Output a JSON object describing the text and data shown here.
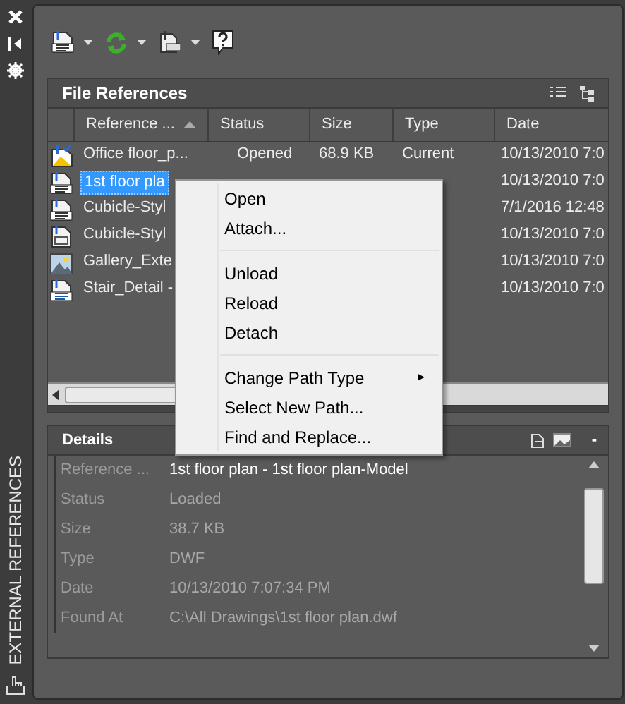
{
  "palette_title": "EXTERNAL REFERENCES",
  "file_references": {
    "title": "File References",
    "columns": [
      {
        "label": "Reference ...",
        "sorted": true
      },
      {
        "label": "Status",
        "sorted": false
      },
      {
        "label": "Size",
        "sorted": false
      },
      {
        "label": "Type",
        "sorted": false
      },
      {
        "label": "Date",
        "sorted": false
      }
    ],
    "rows": [
      {
        "kind": "current",
        "selected": false,
        "cells": [
          {
            "text": "Office floor_p..."
          },
          {
            "text": "Opened"
          },
          {
            "text": "68.9 KB"
          },
          {
            "text": "Current"
          },
          {
            "text": "10/13/2010 7:0"
          }
        ]
      },
      {
        "kind": "dwf",
        "selected": true,
        "cells": [
          {
            "text": "1st floor pla"
          },
          {
            "text": ""
          },
          {
            "text": ""
          },
          {
            "text": ""
          },
          {
            "text": "10/13/2010 7:0"
          }
        ]
      },
      {
        "kind": "dwg",
        "selected": false,
        "cells": [
          {
            "text": "Cubicle-Styl"
          },
          {
            "text": ""
          },
          {
            "text": ""
          },
          {
            "text": ""
          },
          {
            "text": "7/1/2016 12:48"
          }
        ]
      },
      {
        "kind": "sheet",
        "selected": false,
        "cells": [
          {
            "text": "Cubicle-Styl"
          },
          {
            "text": ""
          },
          {
            "text": ""
          },
          {
            "text": ""
          },
          {
            "text": "10/13/2010 7:0"
          }
        ]
      },
      {
        "kind": "image",
        "selected": false,
        "cells": [
          {
            "text": "Gallery_Exte"
          },
          {
            "text": ""
          },
          {
            "text": ""
          },
          {
            "text": ""
          },
          {
            "text": "10/13/2010 7:0"
          }
        ]
      },
      {
        "kind": "dgn",
        "selected": false,
        "cells": [
          {
            "text": "Stair_Detail -"
          },
          {
            "text": ""
          },
          {
            "text": ""
          },
          {
            "text": ""
          },
          {
            "text": "10/13/2010 7:0"
          }
        ]
      }
    ]
  },
  "context_menu": [
    {
      "kind": "item",
      "label": "Open"
    },
    {
      "kind": "item",
      "label": "Attach..."
    },
    {
      "kind": "separator"
    },
    {
      "kind": "item",
      "label": "Unload"
    },
    {
      "kind": "item",
      "label": "Reload"
    },
    {
      "kind": "item",
      "label": "Detach"
    },
    {
      "kind": "separator"
    },
    {
      "kind": "submenu",
      "label": "Change Path Type",
      "arrow": "▸"
    },
    {
      "kind": "item",
      "label": "Select New Path..."
    },
    {
      "kind": "item",
      "label": "Find and Replace..."
    }
  ],
  "details": {
    "title": "Details",
    "minimize": "-",
    "rows": [
      {
        "label": "Reference ...",
        "value": "1st floor plan - 1st floor plan-Model",
        "selected": true
      },
      {
        "label": "Status",
        "value": "Loaded",
        "selected": false
      },
      {
        "label": "Size",
        "value": "38.7 KB",
        "selected": false
      },
      {
        "label": "Type",
        "value": "DWF",
        "selected": false
      },
      {
        "label": "Date",
        "value": "10/13/2010 7:07:34 PM",
        "selected": false
      },
      {
        "label": "Found At",
        "value": "C:\\All Drawings\\1st floor plan.dwf",
        "selected": false
      }
    ]
  }
}
